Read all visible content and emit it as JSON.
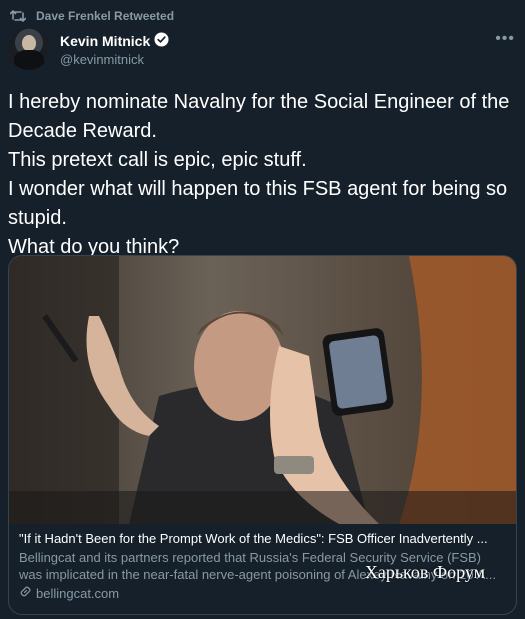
{
  "retweet": {
    "text": "Dave Frenkel Retweeted",
    "icon": "retweet-icon"
  },
  "author": {
    "name": "Kevin Mitnick",
    "handle": "@kevinmitnick",
    "verified": true
  },
  "tweet": {
    "text": "I hereby nominate Navalny for the Social Engineer of the Decade Reward.\nThis pretext call is epic, epic stuff.\nI wonder what will happen to this FSB agent for being so stupid.\nWhat do you think?"
  },
  "card": {
    "title": "\"If it Hadn't Been for the Prompt Work of the Medics\": FSB Officer Inadvertently ...",
    "description": "Bellingcat and its partners reported that Russia's Federal Security Service (FSB) was implicated in the near-fatal nerve-agent poisoning of Alexey Navalny on 20 A...",
    "domain": "bellingcat.com"
  },
  "watermark": "Харьков Форум",
  "colors": {
    "background": "#15202b",
    "secondary_text": "#8899a6",
    "border": "#38444d"
  }
}
